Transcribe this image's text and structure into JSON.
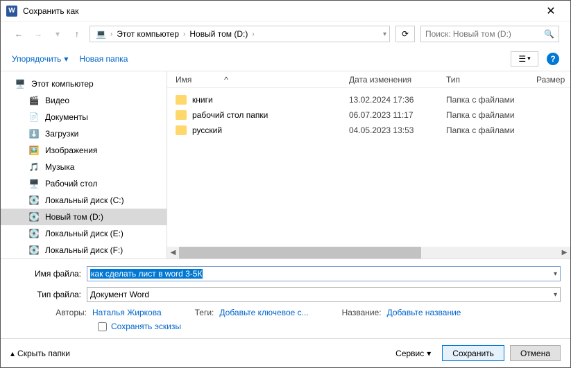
{
  "window": {
    "title": "Сохранить как"
  },
  "breadcrumb": {
    "pc_icon": "💻",
    "parts": [
      "Этот компьютер",
      "Новый том (D:)"
    ],
    "chev": "›",
    "dd": "▾"
  },
  "search": {
    "placeholder": "Поиск: Новый том (D:)",
    "icon": "🔍"
  },
  "toolbar": {
    "organize": "Упорядочить",
    "new_folder": "Новая папка",
    "view_icon": "☰",
    "help": "?"
  },
  "sidebar": [
    {
      "name": "pc",
      "icon": "🖥️",
      "label": "Этот компьютер",
      "child": false
    },
    {
      "name": "videos",
      "icon": "🎬",
      "label": "Видео",
      "child": true
    },
    {
      "name": "documents",
      "icon": "📄",
      "label": "Документы",
      "child": true
    },
    {
      "name": "downloads",
      "icon": "⬇️",
      "label": "Загрузки",
      "child": true
    },
    {
      "name": "pictures",
      "icon": "🖼️",
      "label": "Изображения",
      "child": true
    },
    {
      "name": "music",
      "icon": "🎵",
      "label": "Музыка",
      "child": true
    },
    {
      "name": "desktop",
      "icon": "🖥️",
      "label": "Рабочий стол",
      "child": true
    },
    {
      "name": "drive-c",
      "icon": "💽",
      "label": "Локальный диск (C:)",
      "child": true
    },
    {
      "name": "drive-d",
      "icon": "💽",
      "label": "Новый том (D:)",
      "child": true,
      "selected": true
    },
    {
      "name": "drive-e",
      "icon": "💽",
      "label": "Локальный диск (E:)",
      "child": true
    },
    {
      "name": "drive-f",
      "icon": "💽",
      "label": "Локальный диск (F:)",
      "child": true
    }
  ],
  "cols": {
    "name": "Имя",
    "date": "Дата изменения",
    "type": "Тип",
    "size": "Размер",
    "sort": "^"
  },
  "files": [
    {
      "name": "книги",
      "date": "13.02.2024 17:36",
      "type": "Папка с файлами"
    },
    {
      "name": "рабочий стол папки",
      "date": "06.07.2023 11:17",
      "type": "Папка с файлами"
    },
    {
      "name": "русский",
      "date": "04.05.2023 13:53",
      "type": "Папка с файлами"
    }
  ],
  "form": {
    "filename_label": "Имя файла:",
    "filename_value": "как сделать лист в word 3-5К",
    "filetype_label": "Тип файла:",
    "filetype_value": "Документ Word",
    "authors_label": "Авторы:",
    "authors_value": "Наталья Жиркова",
    "tags_label": "Теги:",
    "tags_value": "Добавьте ключевое с...",
    "title_label": "Название:",
    "title_value": "Добавьте название",
    "save_thumb": "Сохранять эскизы"
  },
  "footer": {
    "hide_folders": "Скрыть папки",
    "tools": "Сервис",
    "save": "Сохранить",
    "cancel": "Отмена"
  }
}
